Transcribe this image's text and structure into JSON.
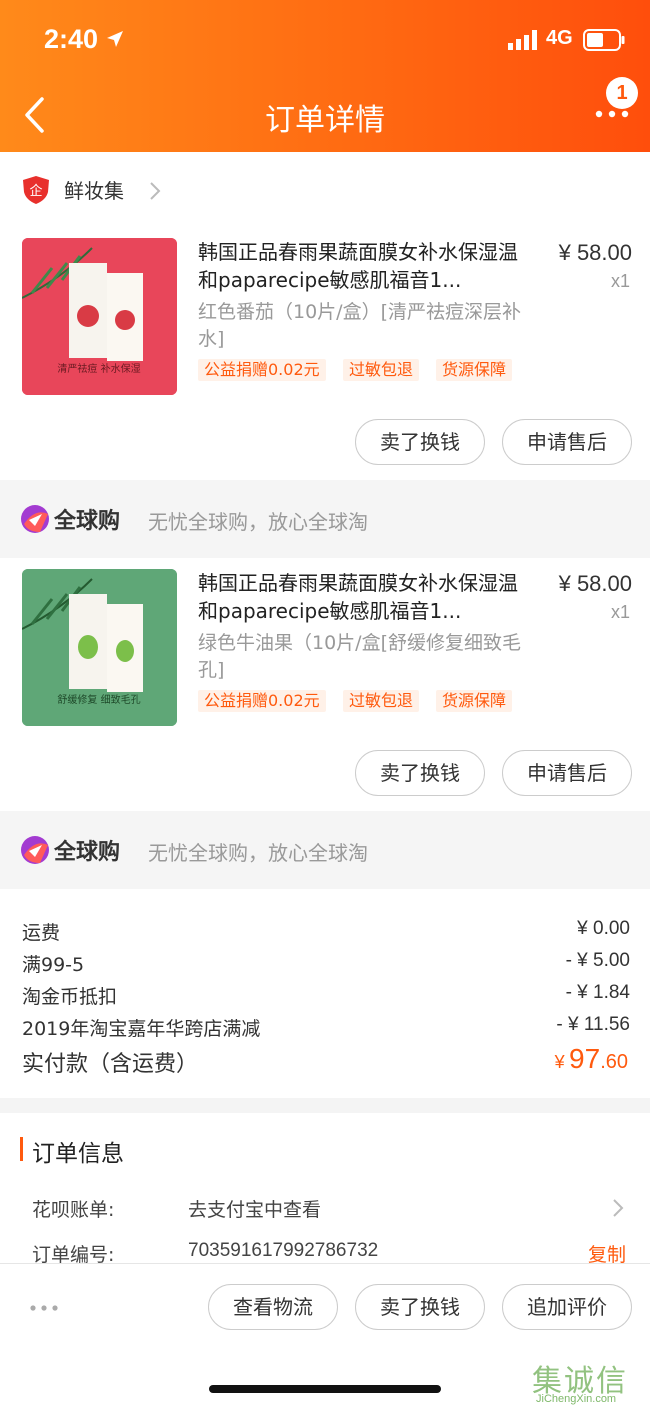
{
  "status_bar": {
    "time": "2:40",
    "network": "4G"
  },
  "header": {
    "title": "订单详情",
    "badge_count": "1"
  },
  "shop": {
    "name": "鲜妆集"
  },
  "products": [
    {
      "title": "韩国正品春雨果蔬面膜女补水保湿温和paparecipe敏感肌福音1...",
      "price": "¥ 58.00",
      "qty": "x1",
      "sku": "红色番茄（10片/盒）[清严祛痘深层补水]",
      "tags": [
        "公益捐赠0.02元",
        "过敏包退",
        "货源保障"
      ],
      "buttons": [
        "卖了换钱",
        "申请售后"
      ],
      "image_caption": "清严祛痘 补水保湿",
      "image_color": "#e8465a"
    },
    {
      "title": "韩国正品春雨果蔬面膜女补水保湿温和paparecipe敏感肌福音1...",
      "price": "¥ 58.00",
      "qty": "x1",
      "sku": "绿色牛油果（10片/盒[舒缓修复细致毛孔]",
      "tags": [
        "公益捐赠0.02元",
        "过敏包退",
        "货源保障"
      ],
      "buttons": [
        "卖了换钱",
        "申请售后"
      ],
      "image_caption": "舒缓修复 细致毛孔",
      "image_color": "#5fa777"
    }
  ],
  "global_bar": {
    "logo": "全球购",
    "slogan": "无忧全球购，放心全球淘"
  },
  "fees": [
    {
      "label": "运费",
      "value": "¥ 0.00"
    },
    {
      "label": "满99-5",
      "value": "- ¥ 5.00"
    },
    {
      "label": "淘金币抵扣",
      "value": "- ¥ 1.84"
    },
    {
      "label": "2019年淘宝嘉年华跨店满减",
      "value": "- ¥ 11.56"
    }
  ],
  "total": {
    "label": "实付款（含运费）",
    "currency": "¥",
    "integer": "97",
    "decimal": ".60"
  },
  "order_info": {
    "heading": "订单信息",
    "huabei_label": "花呗账单:",
    "huabei_value": "去支付宝中查看",
    "order_no_label": "订单编号:",
    "order_no_value": "703591617992786732",
    "copy_label": "复制"
  },
  "bottom_bar": {
    "buttons": [
      "查看物流",
      "卖了换钱",
      "追加评价"
    ]
  },
  "watermark": {
    "brand": "集诚信",
    "url": "JiChengXin.com"
  },
  "colors": {
    "accent": "#ff5a0e",
    "header_start": "#ff8a1a",
    "header_end": "#ff4e0c"
  }
}
